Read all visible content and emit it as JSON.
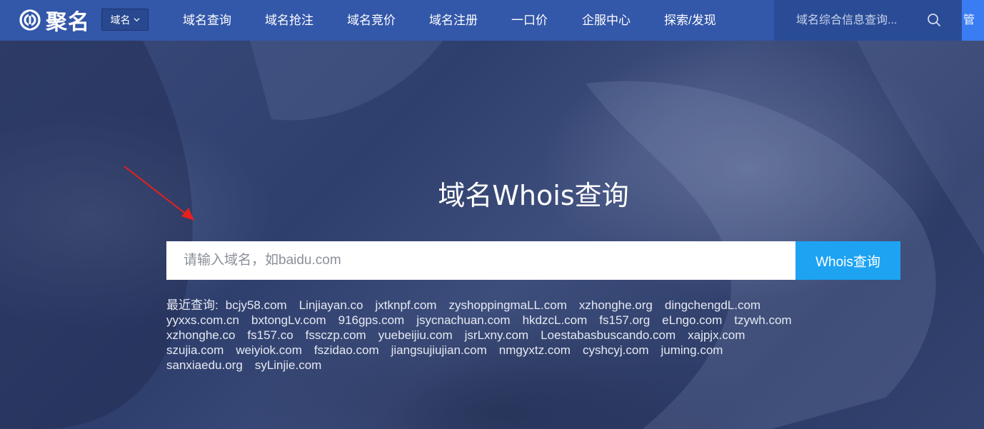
{
  "navbar": {
    "logo_text": "聚名",
    "category_select": "域名",
    "items": [
      "域名查询",
      "域名抢注",
      "域名竞价",
      "域名注册",
      "一口价",
      "企服中心",
      "探索/发现"
    ],
    "search_placeholder": "域名综合信息查询...",
    "edge_label": "管"
  },
  "hero": {
    "title": "域名Whois查询",
    "search_placeholder": "请输入域名，如baidu.com",
    "search_button": "Whois查询"
  },
  "recent": {
    "label": "最近查询:",
    "lines": [
      [
        "bcjy58.com",
        "Linjiayan.co",
        "jxtknpf.com",
        "zyshoppingmaLL.com",
        "xzhonghe.org",
        "dingchengdL.com"
      ],
      [
        "yyxxs.com.cn",
        "bxtongLv.com",
        "916gps.com",
        "jsycnachuan.com",
        "hkdzcL.com",
        "fs157.org",
        "eLngo.com",
        "tzywh.com"
      ],
      [
        "xzhonghe.co",
        "fs157.co",
        "fssczp.com",
        "yuebeijiu.com",
        "jsrLxny.com",
        "Loestabasbuscando.com",
        "xajpjx.com"
      ],
      [
        "szujia.com",
        "weiyiok.com",
        "fszidao.com",
        "jiangsujiujian.com",
        "nmgyxtz.com",
        "cyshcyj.com",
        "juming.com"
      ],
      [
        "sanxiaedu.org",
        "syLinjie.com"
      ]
    ]
  },
  "colors": {
    "navbar_bg": "#3357a9",
    "search_button_bg": "#1ea3f3",
    "annotation_arrow": "#e8201c"
  }
}
